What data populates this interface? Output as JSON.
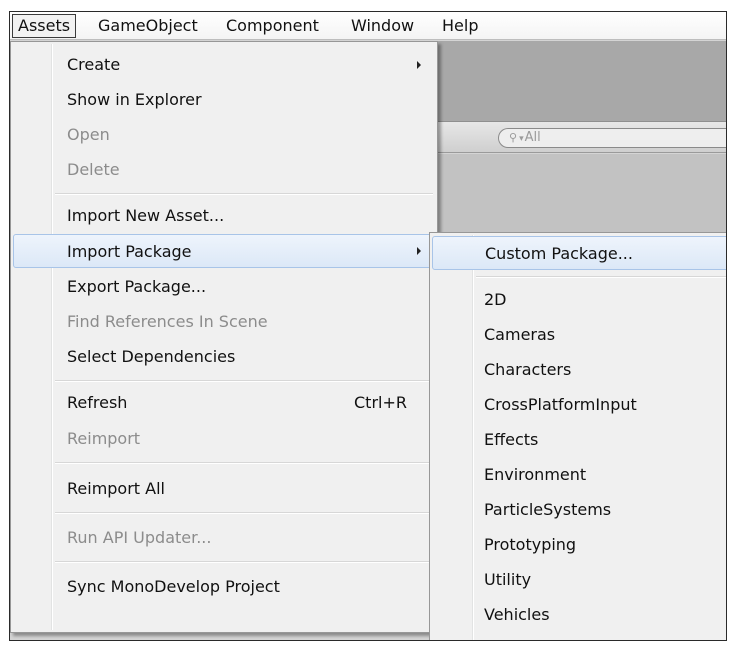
{
  "menubar": {
    "items": [
      {
        "label": "Assets",
        "active": true
      },
      {
        "label": "GameObject"
      },
      {
        "label": "Component"
      },
      {
        "label": "Window"
      },
      {
        "label": "Help"
      }
    ]
  },
  "editor": {
    "search_placeholder": "All"
  },
  "assets_menu": {
    "items": [
      {
        "label": "Create"
      },
      {
        "label": "Show in Explorer"
      },
      {
        "label": "Open"
      },
      {
        "label": "Delete"
      },
      {
        "label": "Import New Asset..."
      },
      {
        "label": "Import Package"
      },
      {
        "label": "Export Package..."
      },
      {
        "label": "Find References In Scene"
      },
      {
        "label": "Select Dependencies"
      },
      {
        "label": "Refresh",
        "shortcut": "Ctrl+R"
      },
      {
        "label": "Reimport"
      },
      {
        "label": "Reimport All"
      },
      {
        "label": "Run API Updater..."
      },
      {
        "label": "Sync MonoDevelop Project"
      }
    ]
  },
  "package_menu": {
    "items": [
      {
        "label": "Custom Package..."
      },
      {
        "label": "2D"
      },
      {
        "label": "Cameras"
      },
      {
        "label": "Characters"
      },
      {
        "label": "CrossPlatformInput"
      },
      {
        "label": "Effects"
      },
      {
        "label": "Environment"
      },
      {
        "label": "ParticleSystems"
      },
      {
        "label": "Prototyping"
      },
      {
        "label": "Utility"
      },
      {
        "label": "Vehicles"
      }
    ]
  },
  "icons": {
    "submenu": "chevron-right-icon",
    "search": "search-icon"
  },
  "colors": {
    "highlight_bg": "#dce8f7",
    "highlight_border": "#a8c4e8",
    "disabled_text": "#8c8c8c",
    "menu_bg": "#f0f0f0"
  }
}
